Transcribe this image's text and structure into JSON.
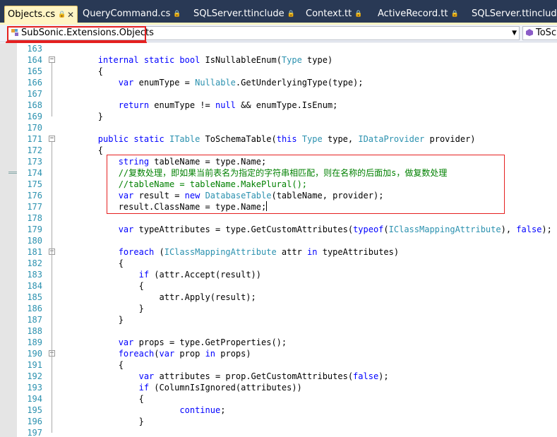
{
  "tabs": [
    {
      "label": "Objects.cs",
      "active": true,
      "locked": true
    },
    {
      "label": "QueryCommand.cs",
      "active": false,
      "locked": true
    },
    {
      "label": "SQLServer.ttinclude",
      "active": false,
      "locked": true
    },
    {
      "label": "Context.tt",
      "active": false,
      "locked": true
    },
    {
      "label": "ActiveRecord.tt",
      "active": false,
      "locked": true
    },
    {
      "label": "SQLServer.ttinclude",
      "active": false,
      "locked": true
    }
  ],
  "navbar": {
    "type_combo": "SubSonic.Extensions.Objects",
    "member_combo": "ToSc"
  },
  "colors": {
    "keyword": "#0000ff",
    "type": "#2b91af",
    "comment": "#008000",
    "line_number": "#2b91af",
    "highlight_box": "#e52020",
    "tab_strip": "#293955",
    "active_tab": "#fff5c4"
  },
  "editor": {
    "lines": [
      {
        "num": "163",
        "tokens": []
      },
      {
        "num": "164",
        "fold": "minus",
        "tokens": [
          [
            "p",
            "        "
          ],
          [
            "kw",
            "internal"
          ],
          [
            "p",
            " "
          ],
          [
            "kw",
            "static"
          ],
          [
            "p",
            " "
          ],
          [
            "kw",
            "bool"
          ],
          [
            "p",
            " IsNullableEnum("
          ],
          [
            "ty",
            "Type"
          ],
          [
            "p",
            " type)"
          ]
        ]
      },
      {
        "num": "165",
        "tokens": [
          [
            "p",
            "        {"
          ]
        ]
      },
      {
        "num": "166",
        "tokens": [
          [
            "p",
            "            "
          ],
          [
            "kw",
            "var"
          ],
          [
            "p",
            " enumType = "
          ],
          [
            "ty",
            "Nullable"
          ],
          [
            "p",
            ".GetUnderlyingType(type);"
          ]
        ]
      },
      {
        "num": "167",
        "tokens": []
      },
      {
        "num": "168",
        "tokens": [
          [
            "p",
            "            "
          ],
          [
            "kw",
            "return"
          ],
          [
            "p",
            " enumType != "
          ],
          [
            "kw",
            "null"
          ],
          [
            "p",
            " && enumType.IsEnum;"
          ]
        ]
      },
      {
        "num": "169",
        "tokens": [
          [
            "p",
            "        }"
          ]
        ]
      },
      {
        "num": "170",
        "tokens": []
      },
      {
        "num": "171",
        "fold": "minus",
        "tokens": [
          [
            "p",
            "        "
          ],
          [
            "kw",
            "public"
          ],
          [
            "p",
            " "
          ],
          [
            "kw",
            "static"
          ],
          [
            "p",
            " "
          ],
          [
            "ty",
            "ITable"
          ],
          [
            "p",
            " ToSchemaTable("
          ],
          [
            "kw",
            "this"
          ],
          [
            "p",
            " "
          ],
          [
            "ty",
            "Type"
          ],
          [
            "p",
            " type, "
          ],
          [
            "ty",
            "IDataProvider"
          ],
          [
            "p",
            " provider)"
          ]
        ]
      },
      {
        "num": "172",
        "tokens": [
          [
            "p",
            "        {"
          ]
        ]
      },
      {
        "num": "173",
        "tokens": [
          [
            "p",
            "            "
          ],
          [
            "kw",
            "string"
          ],
          [
            "p",
            " tableName = type.Name;"
          ]
        ]
      },
      {
        "num": "174",
        "tokens": [
          [
            "p",
            "            "
          ],
          [
            "cm",
            "//复数处理，即如果当前表名为指定的字符串相匹配，则在名称的后面加s，做复数处理"
          ]
        ]
      },
      {
        "num": "175",
        "tokens": [
          [
            "p",
            "            "
          ],
          [
            "cm",
            "//tableName = tableName.MakePlural();"
          ]
        ]
      },
      {
        "num": "176",
        "tokens": [
          [
            "p",
            "            "
          ],
          [
            "kw",
            "var"
          ],
          [
            "p",
            " result = "
          ],
          [
            "kw",
            "new"
          ],
          [
            "p",
            " "
          ],
          [
            "ty",
            "DatabaseTable"
          ],
          [
            "p",
            "(tableName, provider);"
          ]
        ]
      },
      {
        "num": "177",
        "caret": true,
        "tokens": [
          [
            "p",
            "            result.ClassName = type.Name;"
          ]
        ]
      },
      {
        "num": "178",
        "tokens": []
      },
      {
        "num": "179",
        "tokens": [
          [
            "p",
            "            "
          ],
          [
            "kw",
            "var"
          ],
          [
            "p",
            " typeAttributes = type.GetCustomAttributes("
          ],
          [
            "kw",
            "typeof"
          ],
          [
            "p",
            "("
          ],
          [
            "ty",
            "IClassMappingAttribute"
          ],
          [
            "p",
            "), "
          ],
          [
            "kw",
            "false"
          ],
          [
            "p",
            ");"
          ]
        ]
      },
      {
        "num": "180",
        "tokens": []
      },
      {
        "num": "181",
        "fold": "minus",
        "tokens": [
          [
            "p",
            "            "
          ],
          [
            "kw",
            "foreach"
          ],
          [
            "p",
            " ("
          ],
          [
            "ty",
            "IClassMappingAttribute"
          ],
          [
            "p",
            " attr "
          ],
          [
            "kw",
            "in"
          ],
          [
            "p",
            " typeAttributes)"
          ]
        ]
      },
      {
        "num": "182",
        "tokens": [
          [
            "p",
            "            {"
          ]
        ]
      },
      {
        "num": "183",
        "tokens": [
          [
            "p",
            "                "
          ],
          [
            "kw",
            "if"
          ],
          [
            "p",
            " (attr.Accept(result))"
          ]
        ]
      },
      {
        "num": "184",
        "tokens": [
          [
            "p",
            "                {"
          ]
        ]
      },
      {
        "num": "185",
        "tokens": [
          [
            "p",
            "                    attr.Apply(result);"
          ]
        ]
      },
      {
        "num": "186",
        "tokens": [
          [
            "p",
            "                }"
          ]
        ]
      },
      {
        "num": "187",
        "tokens": [
          [
            "p",
            "            }"
          ]
        ]
      },
      {
        "num": "188",
        "tokens": []
      },
      {
        "num": "189",
        "tokens": [
          [
            "p",
            "            "
          ],
          [
            "kw",
            "var"
          ],
          [
            "p",
            " props = type.GetProperties();"
          ]
        ]
      },
      {
        "num": "190",
        "fold": "minus",
        "tokens": [
          [
            "p",
            "            "
          ],
          [
            "kw",
            "foreach"
          ],
          [
            "p",
            "("
          ],
          [
            "kw",
            "var"
          ],
          [
            "p",
            " prop "
          ],
          [
            "kw",
            "in"
          ],
          [
            "p",
            " props)"
          ]
        ]
      },
      {
        "num": "191",
        "tokens": [
          [
            "p",
            "            {"
          ]
        ]
      },
      {
        "num": "192",
        "tokens": [
          [
            "p",
            "                "
          ],
          [
            "kw",
            "var"
          ],
          [
            "p",
            " attributes = prop.GetCustomAttributes("
          ],
          [
            "kw",
            "false"
          ],
          [
            "p",
            ");"
          ]
        ]
      },
      {
        "num": "193",
        "tokens": [
          [
            "p",
            "                "
          ],
          [
            "kw",
            "if"
          ],
          [
            "p",
            " (ColumnIsIgnored(attributes))"
          ]
        ]
      },
      {
        "num": "194",
        "tokens": [
          [
            "p",
            "                {"
          ]
        ]
      },
      {
        "num": "195",
        "tokens": [
          [
            "p",
            "                        "
          ],
          [
            "kw",
            "continue"
          ],
          [
            "p",
            ";"
          ]
        ]
      },
      {
        "num": "196",
        "tokens": [
          [
            "p",
            "                }"
          ]
        ]
      },
      {
        "num": "197",
        "tokens": []
      }
    ]
  }
}
